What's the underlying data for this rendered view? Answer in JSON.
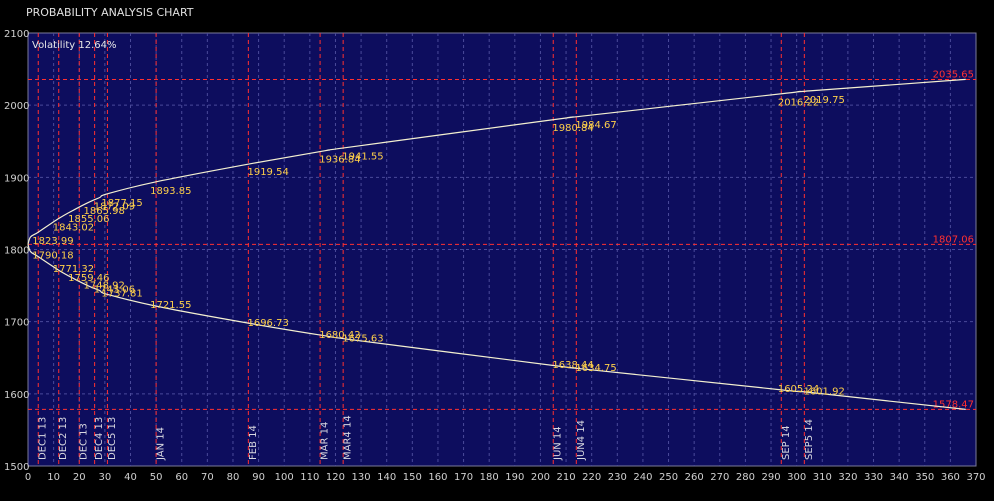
{
  "app": {
    "title": "PROBABILITY ANALYSIS CHART"
  },
  "colors": {
    "background": "#000000",
    "plot_background": "#0d0d5e",
    "grid": "#4a4a9a",
    "curve": "#f4f0d0",
    "data_label": "#ffd04a",
    "reference_line": "#ff3030",
    "expiry_line": "#ff3030"
  },
  "chart_data": {
    "type": "line",
    "title": "PROBABILITY ANALYSIS CHART",
    "annotation": "Volatility 12.64%",
    "xlim": [
      0,
      370
    ],
    "ylim": [
      1500,
      2100
    ],
    "x_ticks": [
      "0",
      "10",
      "20",
      "30",
      "40",
      "50",
      "60",
      "70",
      "80",
      "90",
      "100",
      "110",
      "120",
      "130",
      "140",
      "150",
      "160",
      "170",
      "180",
      "190",
      "200",
      "210",
      "220",
      "230",
      "240",
      "250",
      "260",
      "270",
      "280",
      "290",
      "300",
      "310",
      "320",
      "330",
      "340",
      "350",
      "360",
      "370"
    ],
    "y_ticks": [
      "1500",
      "1600",
      "1700",
      "1800",
      "1900",
      "2000",
      "2100"
    ],
    "grid": true,
    "series": [
      {
        "role": "upper",
        "points": [
          {
            "x": 0,
            "y": 1807.06
          },
          {
            "x": 1,
            "y": 1817.5
          },
          {
            "x": 4,
            "y": 1823.99
          },
          {
            "x": 12,
            "y": 1843.02
          },
          {
            "x": 18,
            "y": 1855.06
          },
          {
            "x": 24,
            "y": 1865.98
          },
          {
            "x": 28,
            "y": 1872.09
          },
          {
            "x": 31,
            "y": 1877.15
          },
          {
            "x": 50,
            "y": 1893.85
          },
          {
            "x": 88,
            "y": 1919.54
          },
          {
            "x": 116,
            "y": 1936.84
          },
          {
            "x": 125,
            "y": 1941.55
          },
          {
            "x": 207,
            "y": 1980.84
          },
          {
            "x": 216,
            "y": 1984.67
          },
          {
            "x": 295,
            "y": 2016.22
          },
          {
            "x": 305,
            "y": 2019.75
          },
          {
            "x": 366,
            "y": 2035.65
          }
        ]
      },
      {
        "role": "lower",
        "points": [
          {
            "x": 0,
            "y": 1807.06
          },
          {
            "x": 1,
            "y": 1797.0
          },
          {
            "x": 4,
            "y": 1790.18
          },
          {
            "x": 12,
            "y": 1771.32
          },
          {
            "x": 18,
            "y": 1759.46
          },
          {
            "x": 24,
            "y": 1748.92
          },
          {
            "x": 28,
            "y": 1743.06
          },
          {
            "x": 31,
            "y": 1737.81
          },
          {
            "x": 50,
            "y": 1721.55
          },
          {
            "x": 88,
            "y": 1696.73
          },
          {
            "x": 116,
            "y": 1680.42
          },
          {
            "x": 125,
            "y": 1675.63
          },
          {
            "x": 207,
            "y": 1638.44
          },
          {
            "x": 216,
            "y": 1634.75
          },
          {
            "x": 295,
            "y": 1605.24
          },
          {
            "x": 305,
            "y": 1601.92
          },
          {
            "x": 366,
            "y": 1578.47
          }
        ]
      }
    ],
    "data_labels_upper": [
      {
        "x": 4,
        "y": 1823.99,
        "text": "1823.99"
      },
      {
        "x": 12,
        "y": 1843.02,
        "text": "1843.02"
      },
      {
        "x": 18,
        "y": 1855.06,
        "text": "1855.06"
      },
      {
        "x": 24,
        "y": 1865.98,
        "text": "1865.98"
      },
      {
        "x": 28,
        "y": 1872.09,
        "text": "1872.09"
      },
      {
        "x": 31,
        "y": 1877.15,
        "text": "1877.15"
      },
      {
        "x": 50,
        "y": 1893.85,
        "text": "1893.85"
      },
      {
        "x": 88,
        "y": 1919.54,
        "text": "1919.54"
      },
      {
        "x": 116,
        "y": 1936.84,
        "text": "1936.84"
      },
      {
        "x": 125,
        "y": 1941.55,
        "text": "1941.55"
      },
      {
        "x": 207,
        "y": 1980.84,
        "text": "1980.84"
      },
      {
        "x": 216,
        "y": 1984.67,
        "text": "1984.67"
      },
      {
        "x": 295,
        "y": 2016.22,
        "text": "2016.22"
      },
      {
        "x": 305,
        "y": 2019.75,
        "text": "2019.75"
      }
    ],
    "data_labels_lower": [
      {
        "x": 4,
        "y": 1790.18,
        "text": "1790.18"
      },
      {
        "x": 12,
        "y": 1771.32,
        "text": "1771.32"
      },
      {
        "x": 18,
        "y": 1759.46,
        "text": "1759.46"
      },
      {
        "x": 24,
        "y": 1748.92,
        "text": "1748.92"
      },
      {
        "x": 28,
        "y": 1743.06,
        "text": "1743.06"
      },
      {
        "x": 31,
        "y": 1737.81,
        "text": "1737.81"
      },
      {
        "x": 50,
        "y": 1721.55,
        "text": "1721.55"
      },
      {
        "x": 88,
        "y": 1696.73,
        "text": "1696.73"
      },
      {
        "x": 116,
        "y": 1680.42,
        "text": "1680.42"
      },
      {
        "x": 125,
        "y": 1675.63,
        "text": "1675.63"
      },
      {
        "x": 207,
        "y": 1638.44,
        "text": "1638.44"
      },
      {
        "x": 216,
        "y": 1634.75,
        "text": "1634.75"
      },
      {
        "x": 295,
        "y": 1605.24,
        "text": "1605.24"
      },
      {
        "x": 305,
        "y": 1601.92,
        "text": "1601.92"
      }
    ],
    "reference_lines": [
      {
        "y": 2035.65,
        "text": "2035.65"
      },
      {
        "y": 1807.06,
        "text": "1807.06"
      },
      {
        "y": 1578.47,
        "text": "1578.47"
      }
    ],
    "expiry_lines": [
      {
        "x": 4,
        "label": "DEC1 13"
      },
      {
        "x": 12,
        "label": "DEC2 13"
      },
      {
        "x": 20,
        "label": "DEC 13"
      },
      {
        "x": 26,
        "label": "DEC4 13"
      },
      {
        "x": 31,
        "label": "DEC5 13"
      },
      {
        "x": 50,
        "label": "JAN 14"
      },
      {
        "x": 86,
        "label": "FEB 14"
      },
      {
        "x": 114,
        "label": "MAR 14"
      },
      {
        "x": 123,
        "label": "MAR4 14"
      },
      {
        "x": 205,
        "label": "JUN 14"
      },
      {
        "x": 214,
        "label": "JUN4 14"
      },
      {
        "x": 294,
        "label": "SEP 14"
      },
      {
        "x": 303,
        "label": "SEP5 14"
      }
    ]
  }
}
